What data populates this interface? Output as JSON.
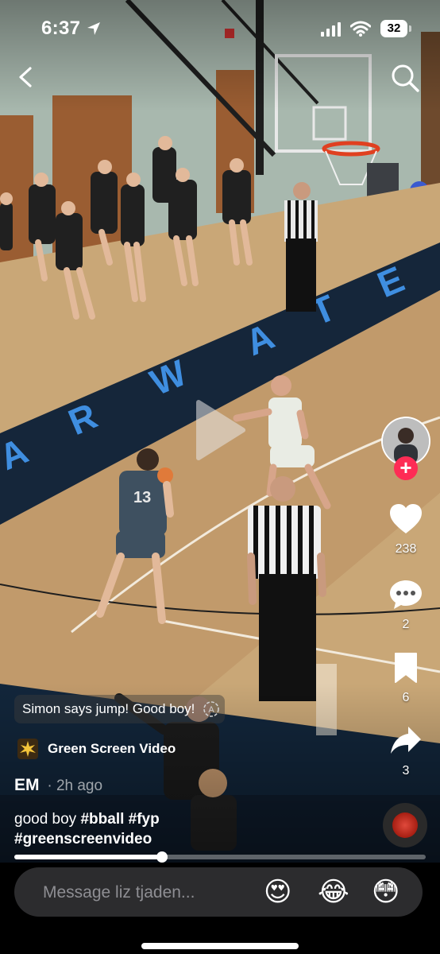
{
  "status_bar": {
    "time": "6:37",
    "battery": "32"
  },
  "icons": {
    "back": "chevron-left-icon",
    "search": "search-icon",
    "play": "play-icon",
    "like": "heart-icon",
    "comment": "comment-icon",
    "save": "bookmark-icon",
    "share": "share-icon"
  },
  "video": {
    "court_lettering": "A R W A T E"
  },
  "rail": {
    "likes": "238",
    "comments": "2",
    "saves": "6",
    "shares": "3",
    "follow_symbol": "+"
  },
  "caption": {
    "sound_label": "Simon says jump! Good boy!",
    "effect_label": "Green Screen Video",
    "author": "EM",
    "post_time": "· 2h ago",
    "text": "good boy",
    "hashtags": [
      "#bball",
      "#fyp",
      "#greenscreenvideo"
    ]
  },
  "progress": {
    "fraction": 0.36
  },
  "message": {
    "placeholder": "Message liz tjaden...",
    "emojis": [
      "😍",
      "😂",
      "😳"
    ]
  },
  "colors": {
    "follow": "#fe2c55",
    "court_blue": "#3f8ee0",
    "court_wood": "#c9a777"
  }
}
